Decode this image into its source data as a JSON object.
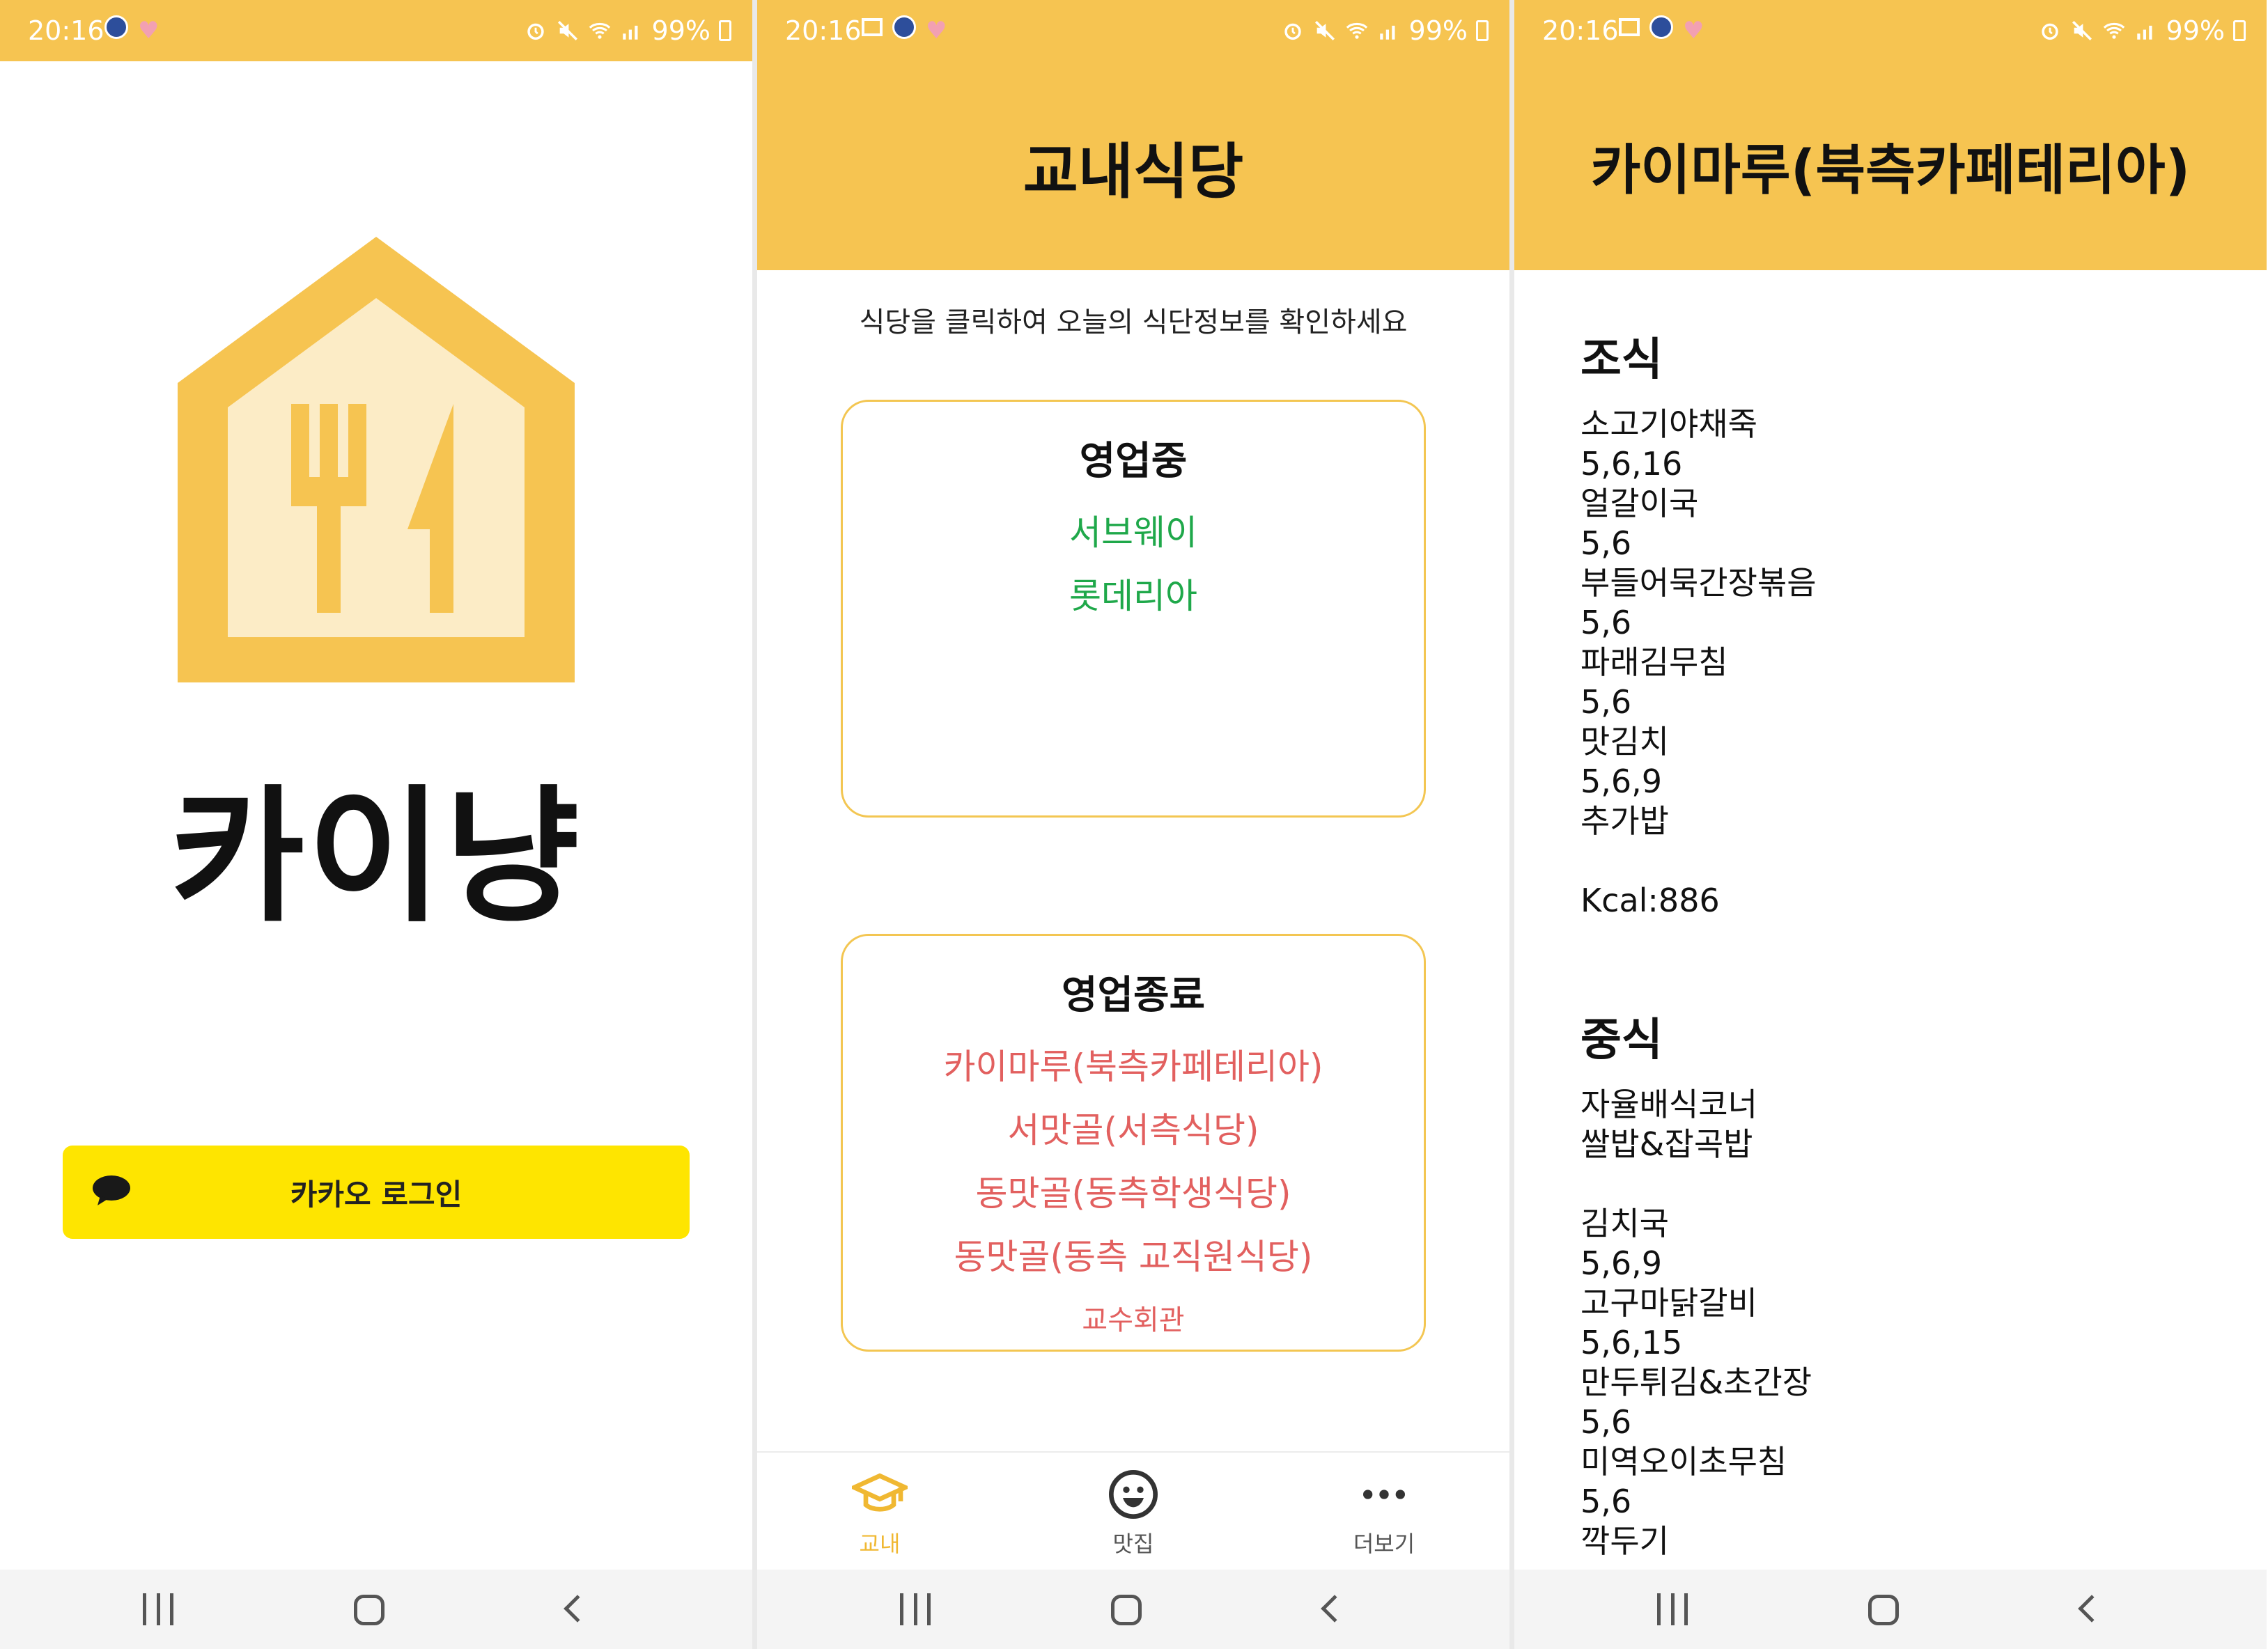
{
  "status": {
    "time": "20:16",
    "battery": "99%"
  },
  "login": {
    "app_title": "카이냥",
    "kakao_button": "카카오 로그인"
  },
  "cafeterias": {
    "header": "교내식당",
    "hint": "식당을 클릭하여 오늘의 식단정보를 확인하세요",
    "open_title": "영업중",
    "open": [
      "서브웨이",
      "롯데리아"
    ],
    "closed_title": "영업종료",
    "closed": [
      "카이마루(북측카페테리아)",
      "서맛골(서측식당)",
      "동맛골(동측학생식당)",
      "동맛골(동측 교직원식당)",
      "교수회관"
    ],
    "tabs": [
      "교내",
      "맛집",
      "더보기"
    ]
  },
  "detail": {
    "header": "카이마루(북측카페테리아)",
    "breakfast_title": "조식",
    "breakfast": [
      "소고기야채죽",
      "5,6,16",
      "얼갈이국",
      "5,6",
      "부들어묵간장볶음",
      "5,6",
      "파래김무침",
      "5,6",
      "맛김치",
      "5,6,9",
      "추가밥",
      "",
      "Kcal:886"
    ],
    "lunch_title": "중식",
    "lunch": [
      "자율배식코너",
      "쌀밥&잡곡밥",
      "",
      "김치국",
      "5,6,9",
      "고구마닭갈비",
      "5,6,15",
      "만두튀김&초간장",
      "5,6",
      "미역오이초무침",
      "5,6",
      "깍두기"
    ]
  },
  "colors": {
    "accent": "#f6c451",
    "kakao": "#fee500",
    "open_green": "#1fa84a",
    "closed_red": "#e2605f"
  },
  "icons": [
    "message-bubble-icon",
    "graduation-cap-icon",
    "smile-icon",
    "more-dots-icon",
    "recent-apps-icon",
    "home-icon",
    "back-icon"
  ]
}
